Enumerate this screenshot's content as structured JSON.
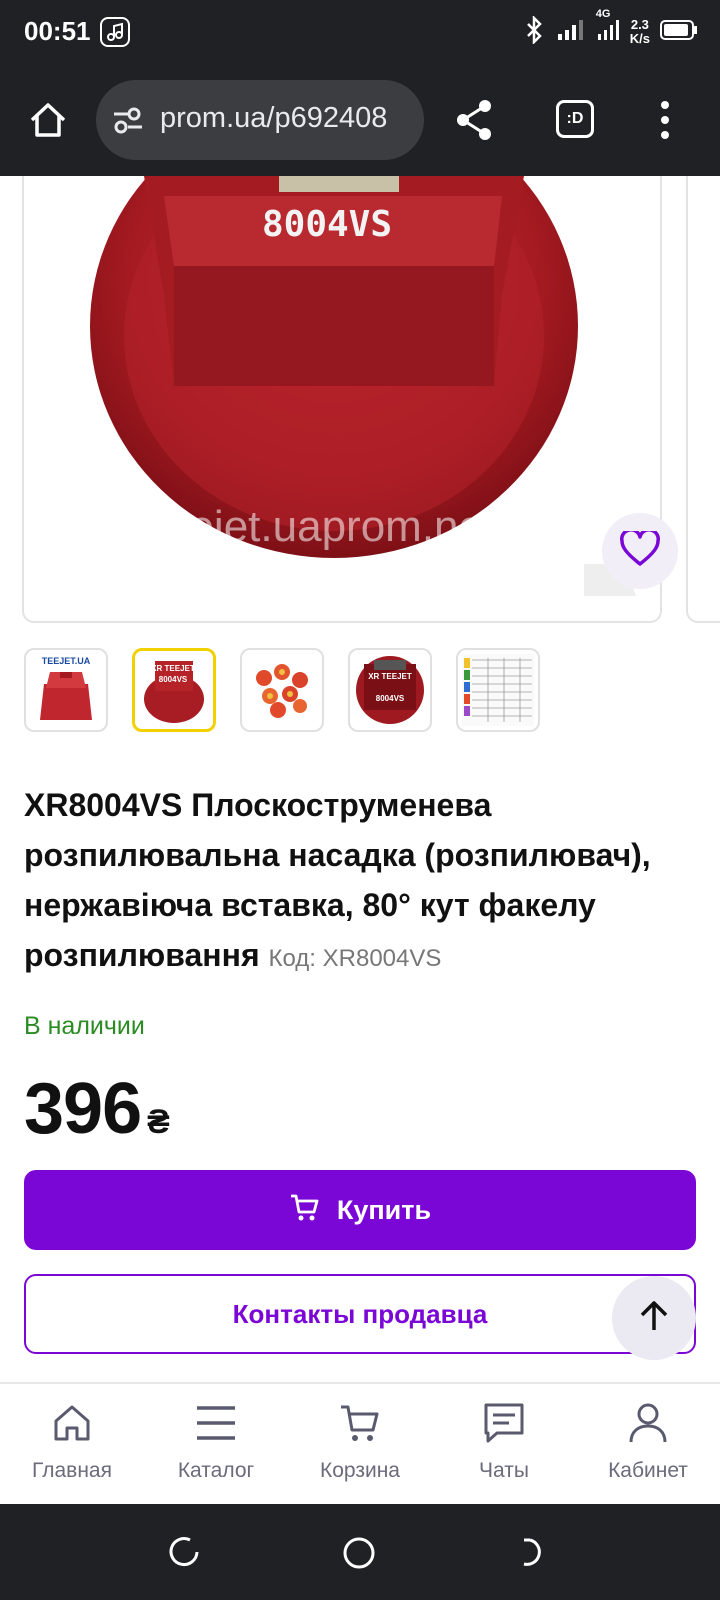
{
  "status_bar": {
    "time": "00:51",
    "network_label": "4G",
    "speed_value": "2.3",
    "speed_unit": "K/s"
  },
  "browser": {
    "url": "prom.ua/p692408",
    "tabs_label": ":D"
  },
  "gallery": {
    "main_image_text": "8004VS",
    "watermark": "teejet.uaprom.net",
    "thumbnails": [
      {
        "label": "TEEJET.UA",
        "active": false
      },
      {
        "label": "XR TEEJET 8004VS",
        "active": true
      },
      {
        "label": "",
        "active": false
      },
      {
        "label": "XR TEEJET 8004VS",
        "active": false
      },
      {
        "label": "",
        "active": false
      }
    ]
  },
  "product": {
    "title": "XR8004VS Плоскоструменева розпилювальна насадка (розпилювач), нержавіюча вставка, 80° кут факелу розпилювання",
    "code": "Код: XR8004VS",
    "availability": "В наличии",
    "price": "396",
    "currency": "₴",
    "buy_label": "Купить",
    "contact_label": "Контакты продавца"
  },
  "bottom_nav": [
    {
      "label": "Главная",
      "icon": "home-icon"
    },
    {
      "label": "Каталог",
      "icon": "menu-icon"
    },
    {
      "label": "Корзина",
      "icon": "cart-icon"
    },
    {
      "label": "Чаты",
      "icon": "chat-icon"
    },
    {
      "label": "Кабинет",
      "icon": "user-icon"
    }
  ],
  "colors": {
    "accent": "#7b07d6",
    "in_stock": "#2c8c24",
    "browser_chrome": "#202124"
  }
}
